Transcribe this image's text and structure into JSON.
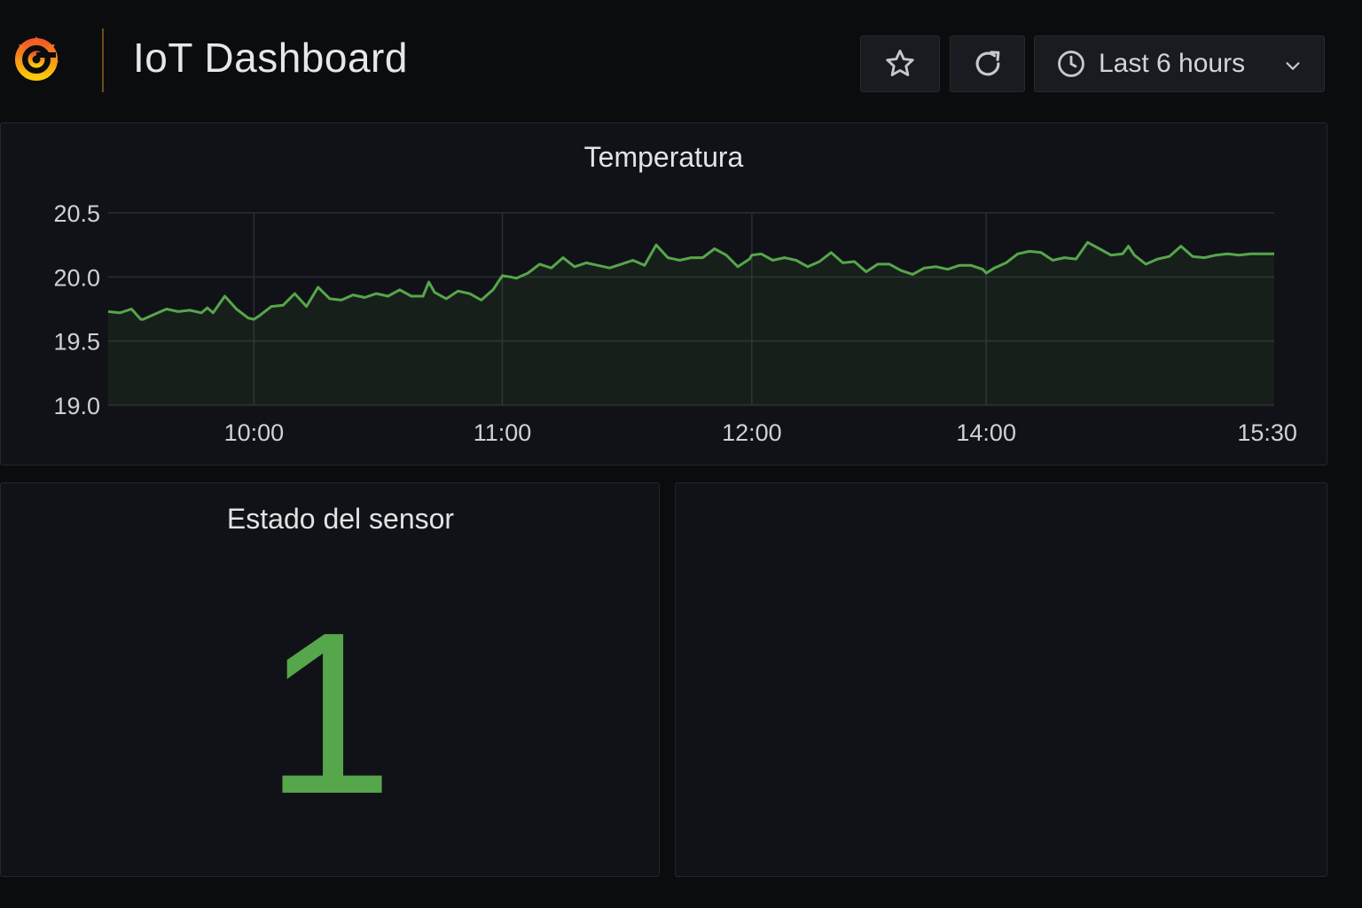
{
  "header": {
    "title": "IoT Dashboard",
    "time_range_label": "Last 6 hours",
    "accent_color": "#f7931e"
  },
  "icons": {
    "logo": "grafana-logo-icon",
    "star": "star-icon",
    "refresh": "refresh-icon",
    "clock": "clock-icon",
    "chevron": "chevron-down-icon"
  },
  "panels": {
    "temperature": {
      "title": "Temperatura"
    },
    "sensor_state": {
      "title": "Estado del sensor",
      "value": "1",
      "value_color": "#56a64b"
    }
  },
  "chart_data": {
    "type": "area",
    "title": "Temperatura",
    "xlabel": "",
    "ylabel": "",
    "ylim": [
      19.0,
      20.5
    ],
    "yticks": [
      19.0,
      19.5,
      20.0,
      20.5
    ],
    "ytick_labels": [
      "19.0",
      "19.5",
      "20.0",
      "20.5"
    ],
    "xtick_labels": [
      "10:00",
      "11:00",
      "12:00",
      "14:00",
      "15:30"
    ],
    "xticks_at": [
      0.125,
      0.338,
      0.552,
      0.753,
      0.994
    ],
    "grid": true,
    "series_color": "#56a64b",
    "series": [
      {
        "x": [
          0,
          0.01,
          0.02,
          0.028,
          0.03,
          0.04,
          0.05,
          0.06,
          0.07,
          0.08,
          0.085,
          0.09,
          0.1,
          0.11,
          0.12,
          0.125,
          0.13,
          0.14,
          0.15,
          0.16,
          0.17,
          0.18,
          0.19,
          0.2,
          0.21,
          0.22,
          0.23,
          0.24,
          0.25,
          0.26,
          0.27,
          0.275,
          0.28,
          0.29,
          0.3,
          0.31,
          0.32,
          0.33,
          0.338,
          0.345,
          0.35,
          0.36,
          0.37,
          0.38,
          0.39,
          0.4,
          0.41,
          0.42,
          0.43,
          0.44,
          0.45,
          0.46,
          0.47,
          0.48,
          0.49,
          0.5,
          0.505,
          0.51,
          0.52,
          0.53,
          0.54,
          0.55,
          0.552,
          0.56,
          0.57,
          0.58,
          0.59,
          0.6,
          0.61,
          0.62,
          0.63,
          0.64,
          0.65,
          0.66,
          0.67,
          0.68,
          0.69,
          0.7,
          0.71,
          0.72,
          0.73,
          0.74,
          0.75,
          0.753,
          0.76,
          0.77,
          0.78,
          0.79,
          0.8,
          0.81,
          0.82,
          0.83,
          0.84,
          0.85,
          0.86,
          0.87,
          0.875,
          0.88,
          0.89,
          0.9,
          0.91,
          0.92,
          0.93,
          0.94,
          0.95,
          0.96,
          0.97,
          0.98,
          0.99,
          1.0
        ],
        "y": [
          19.73,
          19.72,
          19.75,
          19.67,
          19.67,
          19.71,
          19.75,
          19.73,
          19.74,
          19.72,
          19.76,
          19.72,
          19.85,
          19.75,
          19.68,
          19.67,
          19.7,
          19.77,
          19.78,
          19.87,
          19.77,
          19.92,
          19.83,
          19.82,
          19.86,
          19.84,
          19.87,
          19.85,
          19.9,
          19.85,
          19.85,
          19.96,
          19.88,
          19.83,
          19.89,
          19.87,
          19.82,
          19.9,
          20.01,
          20.0,
          19.99,
          20.03,
          20.1,
          20.07,
          20.15,
          20.08,
          20.11,
          20.09,
          20.07,
          20.1,
          20.13,
          20.09,
          20.25,
          20.15,
          20.13,
          20.15,
          20.15,
          20.15,
          20.22,
          20.17,
          20.08,
          20.14,
          20.17,
          20.18,
          20.13,
          20.15,
          20.13,
          20.08,
          20.12,
          20.19,
          20.11,
          20.12,
          20.04,
          20.1,
          20.1,
          20.05,
          20.02,
          20.07,
          20.08,
          20.06,
          20.09,
          20.09,
          20.06,
          20.03,
          20.07,
          20.11,
          20.18,
          20.2,
          20.19,
          20.13,
          20.15,
          20.14,
          20.27,
          20.22,
          20.17,
          20.18,
          20.24,
          20.17,
          20.1,
          20.14,
          20.16,
          20.24,
          20.16,
          20.15,
          20.17,
          20.18,
          20.17,
          20.18,
          20.18,
          20.18
        ]
      }
    ]
  }
}
